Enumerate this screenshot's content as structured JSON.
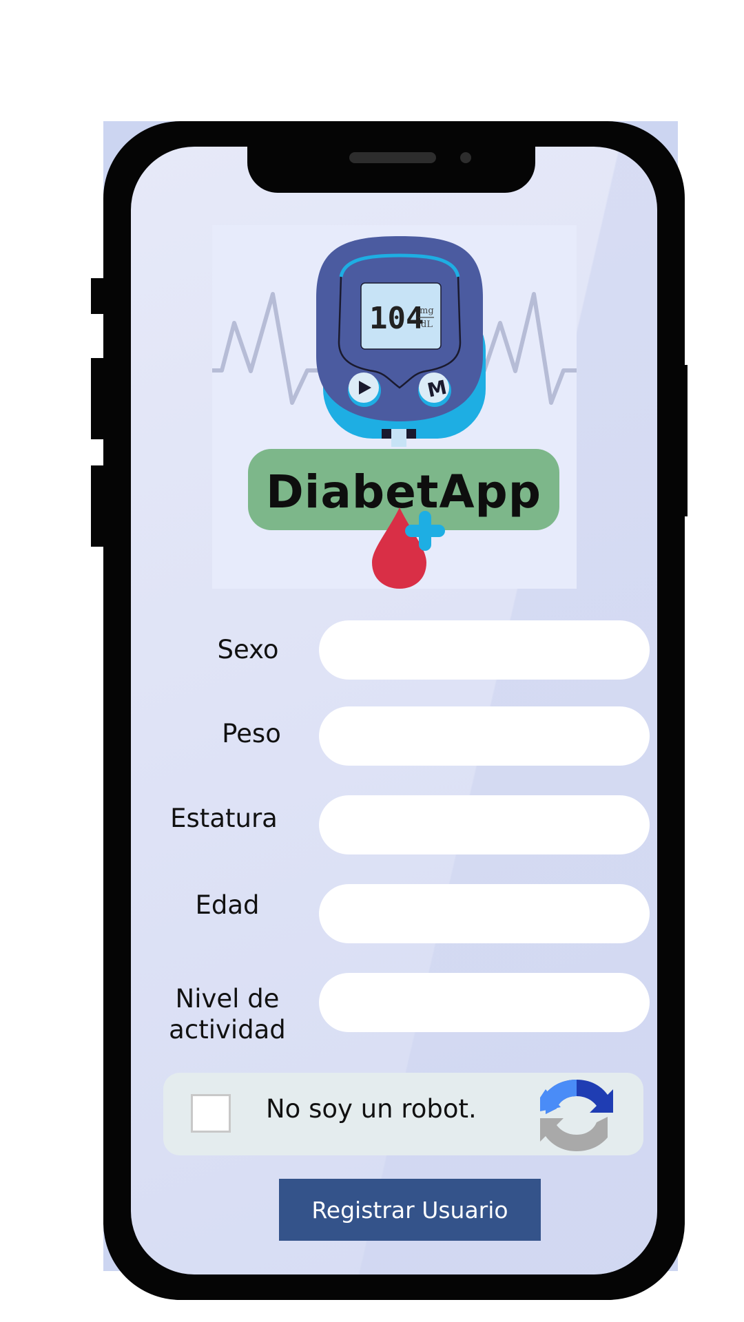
{
  "app": {
    "logo_text": "DiabetApp",
    "meter_reading": "104",
    "meter_unit_top": "mg",
    "meter_unit_bottom": "dL",
    "meter_button_label": "M"
  },
  "form": {
    "fields": [
      {
        "label": "Sexo",
        "value": ""
      },
      {
        "label": "Peso",
        "value": ""
      },
      {
        "label": "Estatura",
        "value": ""
      },
      {
        "label": "Edad",
        "value": ""
      },
      {
        "label_line1": "Nivel de",
        "label_line2": "actividad",
        "value": ""
      }
    ]
  },
  "captcha": {
    "label": "No soy un robot.",
    "checked": false,
    "icon": "recaptcha-icon"
  },
  "submit": {
    "label": "Registrar Usuario"
  },
  "colors": {
    "phone_frame": "#050505",
    "screen_bg": "#e0e4f7",
    "logo_banner": "#7db78a",
    "meter_body": "#4b5ba0",
    "meter_accent": "#1eaee3",
    "blood_drop": "#d92f46",
    "button": "#34538a"
  }
}
